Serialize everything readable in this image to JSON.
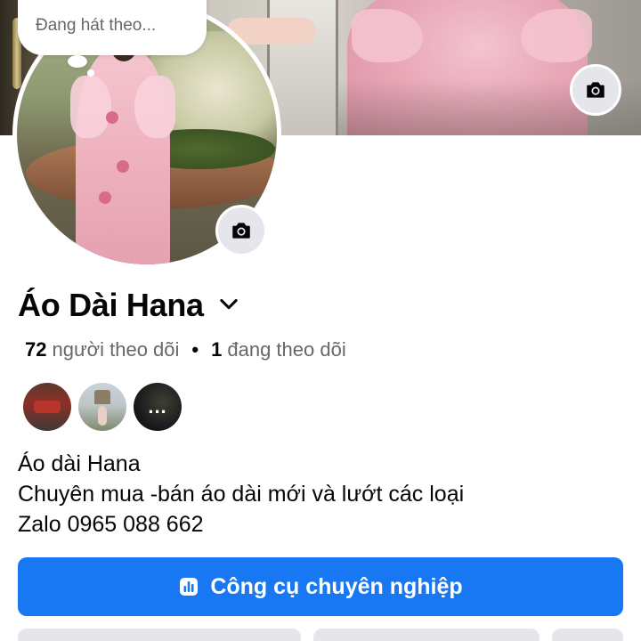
{
  "profile": {
    "status_bubble": "Đang hát theo...",
    "name": "Áo Dài Hana",
    "followers_count": "72",
    "followers_label": "người theo dõi",
    "following_count": "1",
    "following_label": "đang theo dõi",
    "more_friends": "...",
    "bio": [
      "Áo dài Hana",
      "Chuyên mua -bán áo dài mới và lướt các loại",
      "Zalo 0965 088 662"
    ],
    "pro_tools_label": "Công cụ chuyên nghiệp"
  },
  "icons": {
    "cover_camera": "camera-icon",
    "avatar_camera": "camera-icon",
    "name_dropdown": "chevron-down-icon",
    "pro_tools": "dashboard-icon"
  },
  "colors": {
    "primary": "#1877f2",
    "secondary_button": "#e4e6eb",
    "muted_text": "#65676b"
  }
}
